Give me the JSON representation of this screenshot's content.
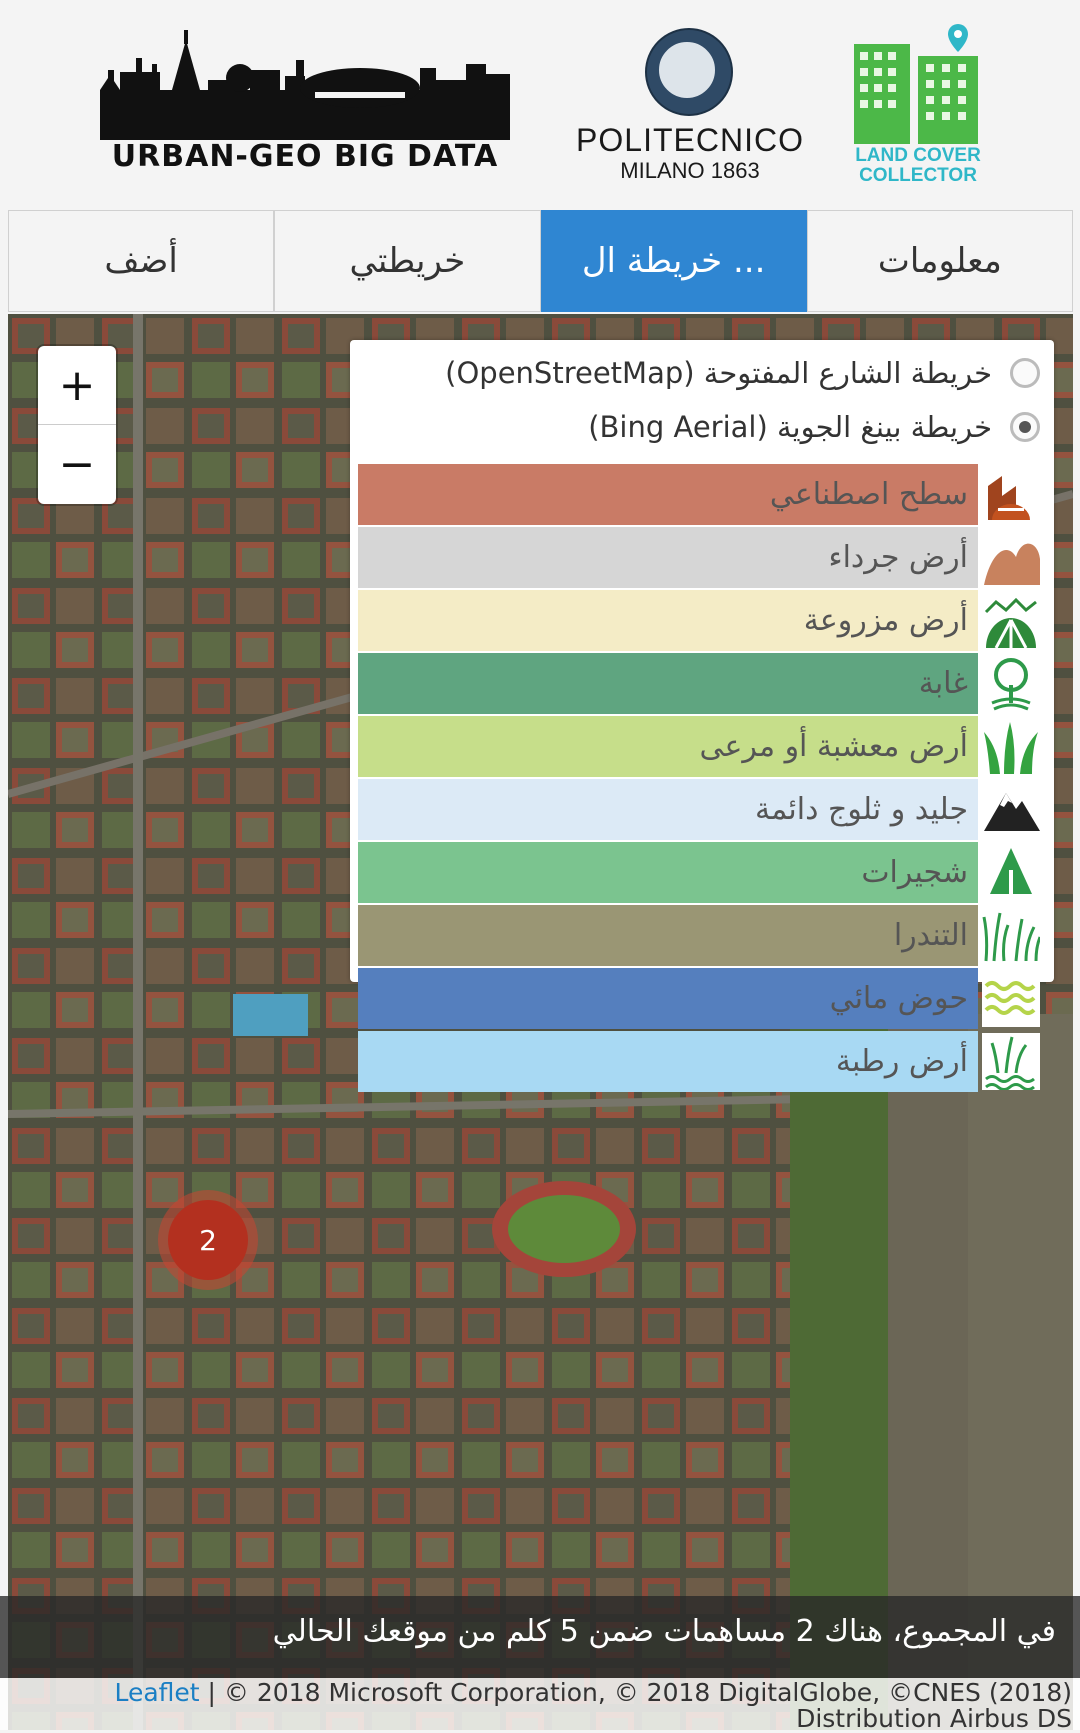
{
  "header": {
    "urban_logo_text": "URBAN-GEO BIG DATA",
    "poli_name": "POLITECNICO",
    "poli_year": "MILANO 1863",
    "lcc_line1": "LAND COVER",
    "lcc_line2": "COLLECTOR"
  },
  "tabs": [
    {
      "label": "أضف",
      "active": false
    },
    {
      "label": "خريطتي",
      "active": false
    },
    {
      "label": "خريطة ال ...",
      "active": true
    },
    {
      "label": "معلومات",
      "active": false
    }
  ],
  "map": {
    "zoom_in": "+",
    "zoom_out": "−",
    "base_layers": [
      {
        "label": "خريطة الشارع المفتوحة (OpenStreetMap)",
        "checked": false
      },
      {
        "label": "خريطة بينغ الجوية (Bing Aerial)",
        "checked": true
      }
    ],
    "legend": [
      {
        "label": "سطح اصطناعي",
        "color": "#c97b66",
        "icon": "building-icon"
      },
      {
        "label": "أرض جرداء",
        "color": "#d6d6d6",
        "icon": "bare-land-icon"
      },
      {
        "label": "أرض مزروعة",
        "color": "#f4ecc6",
        "icon": "cultivated-field-icon"
      },
      {
        "label": "غابة",
        "color": "#5fa580",
        "icon": "tree-icon"
      },
      {
        "label": "أرض معشبة أو مرعى",
        "color": "#c6de8a",
        "icon": "grass-icon"
      },
      {
        "label": "جليد و ثلوج دائمة",
        "color": "#dceaf6",
        "icon": "mountain-icon"
      },
      {
        "label": "شجيرات",
        "color": "#7bc48f",
        "icon": "shrub-icon"
      },
      {
        "label": "التندرا",
        "color": "#9a9674",
        "icon": "tundra-icon"
      },
      {
        "label": "حوض مائي",
        "color": "#557fbe",
        "icon": "water-icon"
      },
      {
        "label": "أرض رطبة",
        "color": "#a8d9f3",
        "icon": "wetland-icon"
      }
    ],
    "cluster_count": "2"
  },
  "status": {
    "text": "في المجموع، هناك 2 مساهمات ضمن 5 كلم من موقعك الحالي"
  },
  "attribution": {
    "leaflet": "Leaflet",
    "line1": " | © 2018 Microsoft Corporation, © 2018 DigitalGlobe, ©CNES (2018)",
    "line2": "Distribution Airbus DS"
  }
}
